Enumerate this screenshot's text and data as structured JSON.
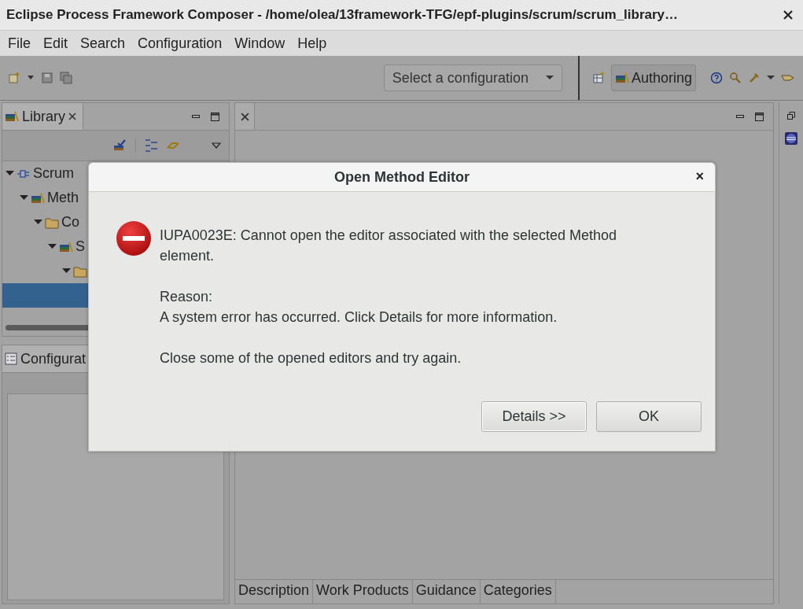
{
  "window": {
    "title": "Eclipse Process Framework Composer - /home/olea/13framework-TFG/epf-plugins/scrum/scrum_library…"
  },
  "menu": [
    "File",
    "Edit",
    "Search",
    "Configuration",
    "Window",
    "Help"
  ],
  "toolbar": {
    "configuration_select": "Select a configuration",
    "perspective": "Authoring"
  },
  "library_view": {
    "title": "Library",
    "tree": [
      {
        "label": "Scrum",
        "expanded": true,
        "selected": false,
        "children": [
          {
            "label": "Meth",
            "expanded": true,
            "selected": false,
            "children": [
              {
                "label": "Co",
                "expanded": true,
                "selected": false,
                "children": [
                  {
                    "label": "S",
                    "expanded": true,
                    "selected": false,
                    "children": [
                      {
                        "expanded": true,
                        "selected": false,
                        "children": [
                          {
                            "selected": true
                          }
                        ]
                      }
                    ]
                  }
                ]
              }
            ]
          }
        ]
      }
    ]
  },
  "configuration_view": {
    "title": "Configurat"
  },
  "editor": {
    "tabs": [
      "Description",
      "Work Products",
      "Guidance",
      "Categories"
    ]
  },
  "dialog": {
    "title": "Open Method Editor",
    "close": "×",
    "message": "IUPA0023E: Cannot open the editor associated with the selected Method element.",
    "reason_label": "Reason:",
    "reason": "A system error has occurred. Click Details for more information.",
    "hint": "Close some of the opened editors and try again.",
    "buttons": [
      {
        "label": "Details >>",
        "kind": "details"
      },
      {
        "label": "OK",
        "kind": "ok"
      }
    ]
  }
}
